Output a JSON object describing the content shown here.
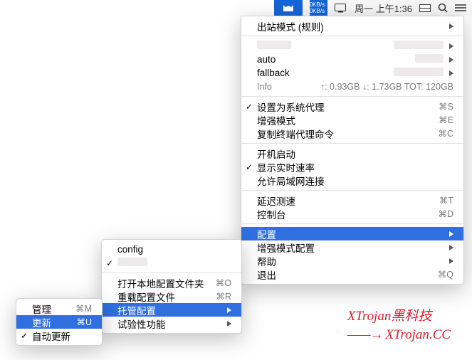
{
  "menubar": {
    "rate_up": "0KB/s",
    "rate_down": "0KB/s",
    "clock": "周一 上午1:36"
  },
  "main_menu": {
    "outbound": "出站模式 (规则)",
    "auto": "auto",
    "fallback": "fallback",
    "info_label": "Info",
    "info_text": "↑: 0.93GB ↓: 1.73GB TOT: 120GB",
    "system_proxy": "设置为系统代理",
    "system_proxy_sc": "⌘S",
    "enhance_mode": "增强模式",
    "enhance_mode_sc": "⌘E",
    "copy_cmd": "复制终端代理命令",
    "copy_cmd_sc": "⌘C",
    "startup": "开机启动",
    "realtime": "显示实时速率",
    "lan": "允许局域网连接",
    "latency": "延迟测速",
    "latency_sc": "⌘T",
    "console": "控制台",
    "console_sc": "⌘D",
    "config": "配置",
    "enh_config": "增强模式配置",
    "help": "帮助",
    "quit": "退出",
    "quit_sc": "⌘Q"
  },
  "sub1": {
    "config": "config",
    "open_folder": "打开本地配置文件夹",
    "open_folder_sc": "⌘O",
    "reload": "重载配置文件",
    "reload_sc": "⌘R",
    "managed": "托管配置",
    "experimental": "试验性功能"
  },
  "sub2": {
    "manage": "管理",
    "manage_sc": "⌘M",
    "update": "更新",
    "update_sc": "⌘U",
    "auto_update": "自动更新"
  },
  "watermark": {
    "line1": "XTrojan黑科技",
    "line2": "XTrojan.CC"
  }
}
